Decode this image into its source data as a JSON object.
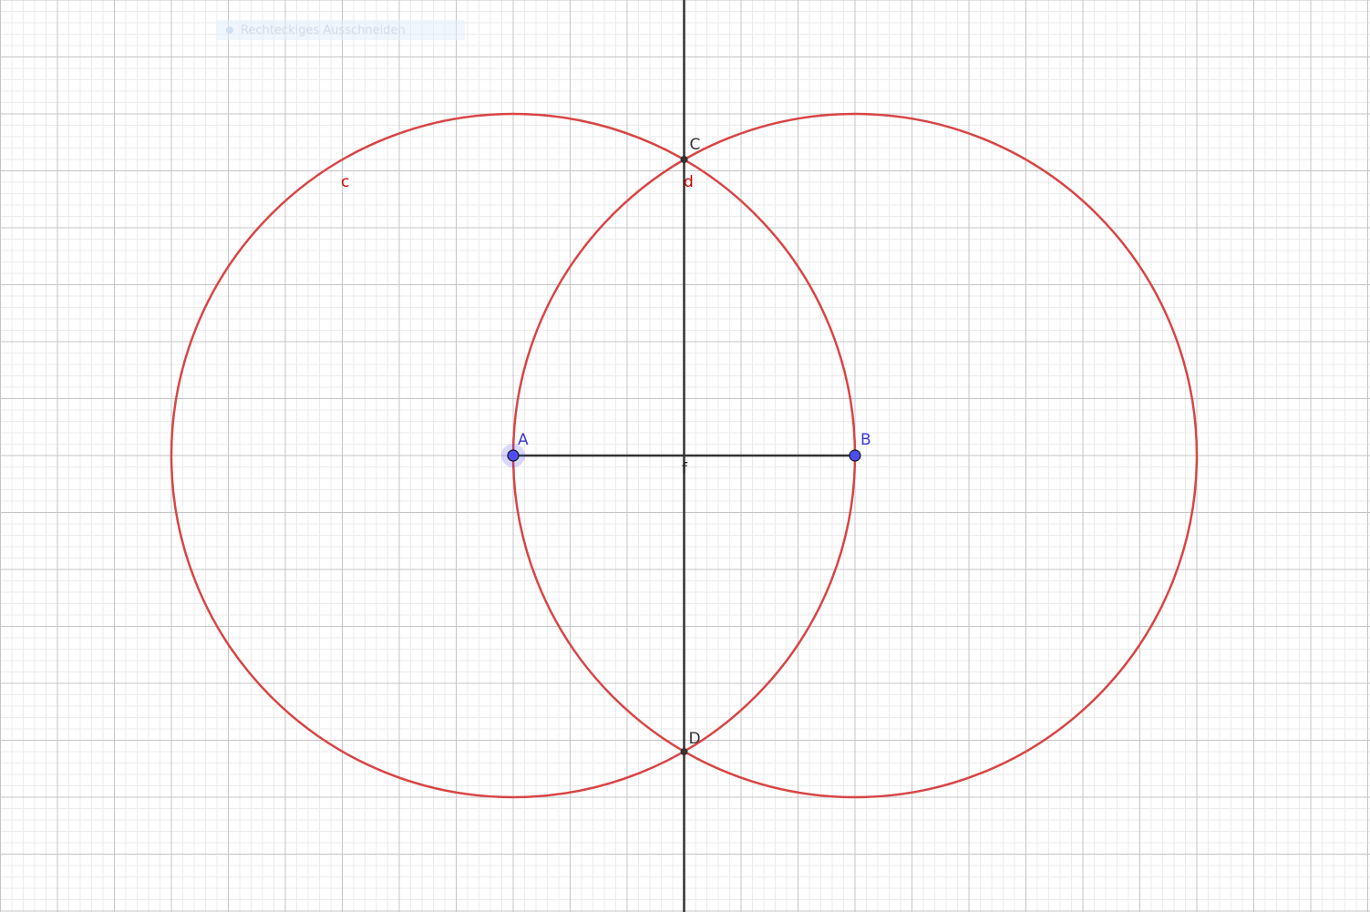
{
  "toolbar_hint": {
    "text": "Rechteckiges Ausschneiden"
  },
  "colors": {
    "circle": "#d84545",
    "line": "#333333",
    "free_point": "#4d4df0",
    "free_point_label": "#3a3adc",
    "intersection_point": "#333333",
    "circle_label": "#cc0000",
    "grid_major": "#c4c4c4",
    "grid_minor": "#ebebeb"
  },
  "diagram": {
    "points": {
      "A": {
        "label": "A",
        "x": 0,
        "y": 0,
        "kind": "free"
      },
      "B": {
        "label": "B",
        "x": 6,
        "y": 0,
        "kind": "free"
      },
      "C": {
        "label": "C",
        "x": 3,
        "y": 5.2,
        "kind": "intersection"
      },
      "D": {
        "label": "D",
        "x": 3,
        "y": -5.2,
        "kind": "intersection"
      }
    },
    "circles": {
      "c": {
        "label": "c",
        "center": "A",
        "through": "B"
      },
      "d": {
        "label": "d",
        "center": "B",
        "through": "A"
      }
    },
    "segment": {
      "label": "f",
      "from": "A",
      "to": "B"
    },
    "perpendicular_bisector": {
      "through": [
        "C",
        "D"
      ]
    }
  }
}
